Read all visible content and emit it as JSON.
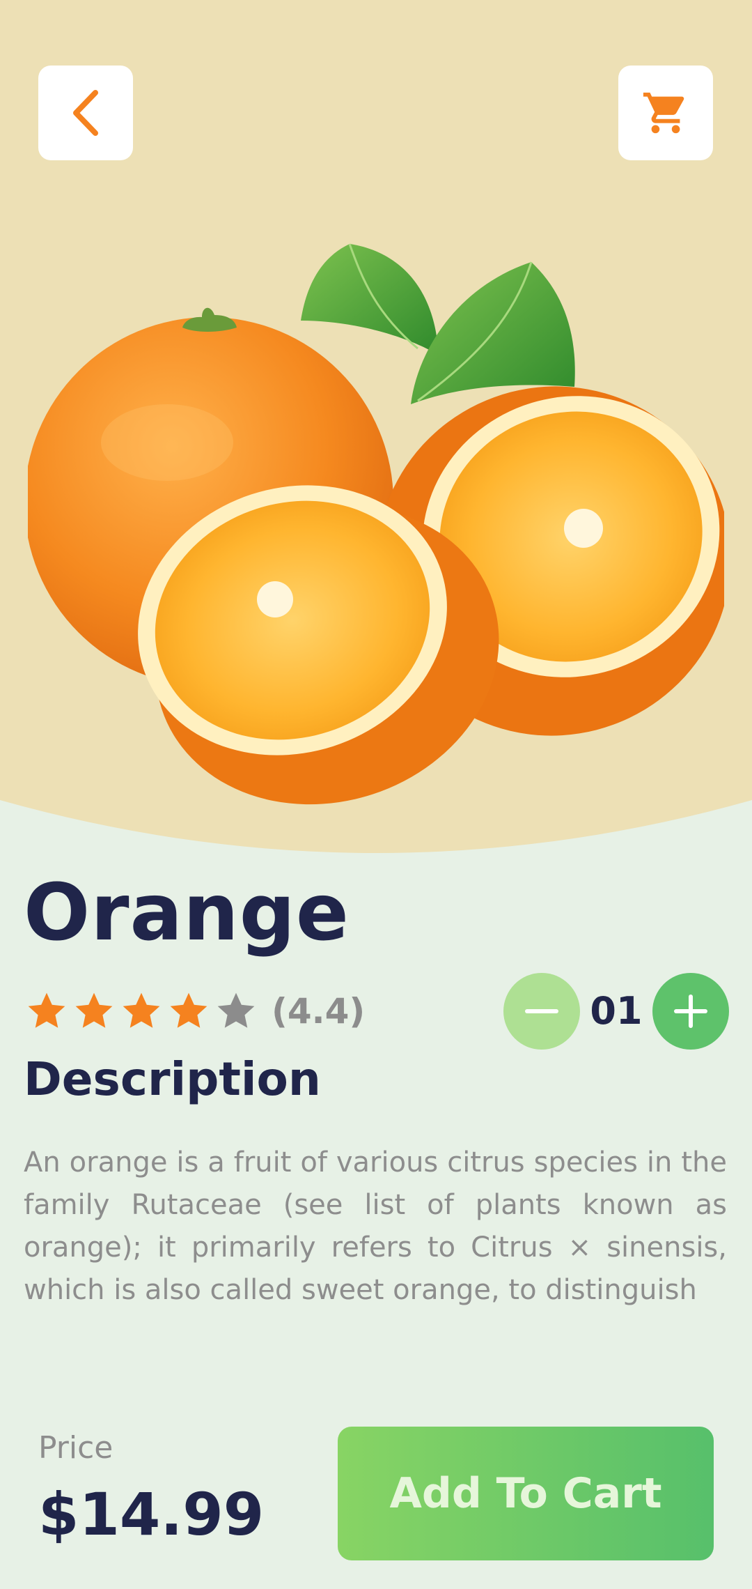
{
  "product": {
    "name": "Orange",
    "rating": 4.4,
    "rating_text": "(4.4)",
    "stars": [
      "filled",
      "filled",
      "filled",
      "filled",
      "empty"
    ],
    "quantity": "01"
  },
  "description": {
    "heading": "Description",
    "text": "An orange is a fruit of various citrus species in the family Rutaceae (see list of plants known as orange); it primarily refers to Citrus × sinensis, which is also called sweet orange, to distinguish"
  },
  "footer": {
    "price_label": "Price",
    "price_value": "$14.99",
    "add_to_cart_label": "Add To Cart"
  },
  "icons": {
    "back": "chevron-left-icon",
    "cart": "shopping-cart-icon",
    "minus": "minus-icon",
    "plus": "plus-icon",
    "star": "star-icon"
  },
  "colors": {
    "accent_orange": "#f5821f",
    "header_background": "#ede0b5",
    "page_background": "#e7f1e6",
    "green_primary": "#5ec26b",
    "green_light": "#aee093",
    "text_dark": "#20254a",
    "text_muted": "#8d8d8d"
  }
}
